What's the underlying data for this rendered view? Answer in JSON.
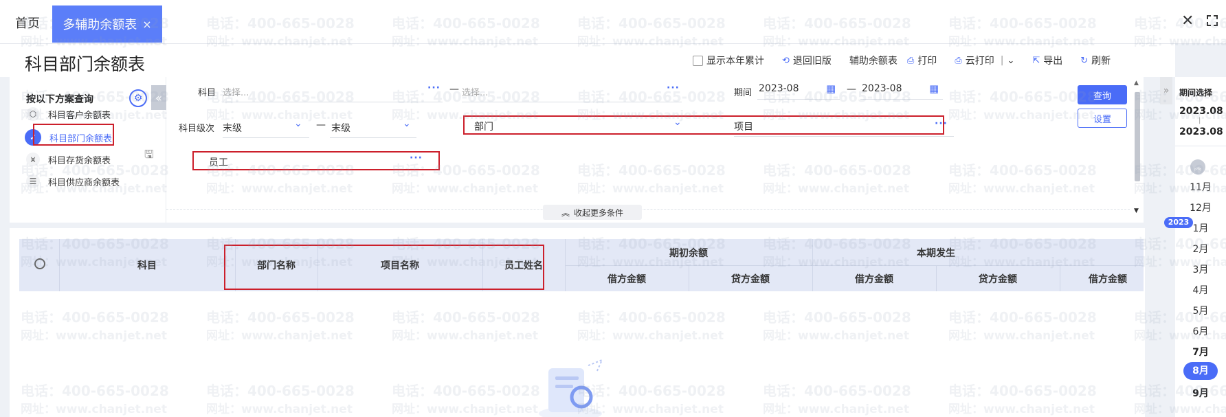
{
  "tabs": {
    "home": "首页",
    "active": "多辅助余额表",
    "close": "×"
  },
  "window": {
    "close": "✕",
    "fullscreen": "⛶"
  },
  "page": {
    "title": "科目部门余额表"
  },
  "toolbar": {
    "show_year_total": "显示本年累计",
    "revert_old": "退回旧版",
    "aux_balance": "辅助余额表",
    "print": "打印",
    "cloud_print": "云打印",
    "cloud_print_sep": "|",
    "export": "导出",
    "refresh": "刷新",
    "icons": {
      "revert": "undo-icon",
      "print": "printer-icon",
      "cloud_print": "cloud-printer-icon",
      "export": "export-icon",
      "refresh": "refresh-icon"
    }
  },
  "scheme_panel": {
    "title": "按以下方案查询",
    "items": [
      {
        "label": "科目客户余额表",
        "icon": "cube-icon",
        "active": false
      },
      {
        "label": "科目部门余额表",
        "icon": "check-circle-icon",
        "active": true
      },
      {
        "label": "科目存货余额表",
        "icon": "chart-icon",
        "active": false
      },
      {
        "label": "科目供应商余额表",
        "icon": "list-icon",
        "active": false
      }
    ]
  },
  "filters": {
    "subject_label": "科目",
    "subject_from_placeholder": "选择...",
    "subject_to_placeholder": "选择...",
    "dash": "—",
    "period_label": "期间",
    "period_from": "2023-08",
    "period_to": "2023-08",
    "level_label": "科目级次",
    "level_from": "末级",
    "level_to": "末级",
    "dept_label": "部门",
    "project_label": "项目",
    "employee_label": "员工",
    "more_conditions": "收起更多条件",
    "ellipsis": "···"
  },
  "buttons": {
    "query": "查询",
    "settings": "设置"
  },
  "table": {
    "columns": {
      "subject": "科目",
      "dept_name": "部门名称",
      "project_name": "项目名称",
      "employee_name": "员工姓名",
      "opening_balance": "期初余额",
      "current_period": "本期发生",
      "debit": "借方金额",
      "credit": "贷方金额"
    }
  },
  "period_panel": {
    "title": "期间选择",
    "range_from": "2023.08",
    "range_to": "2023.08",
    "range_sep": "|",
    "year_badge": "2023",
    "months_prev": [
      "11月",
      "12月"
    ],
    "months": [
      "1月",
      "2月",
      "3月",
      "4月",
      "5月",
      "6月",
      "7月",
      "8月",
      "9月"
    ],
    "selected": "8月"
  },
  "watermark": {
    "phone": "电话：400-665-0028",
    "site": "网址：www.chanjet.net"
  },
  "colors": {
    "accent": "#4a6cf7",
    "tab_active": "#5b7ef9",
    "highlight_box": "#cc1f2b",
    "table_header": "#e3e8f6"
  }
}
